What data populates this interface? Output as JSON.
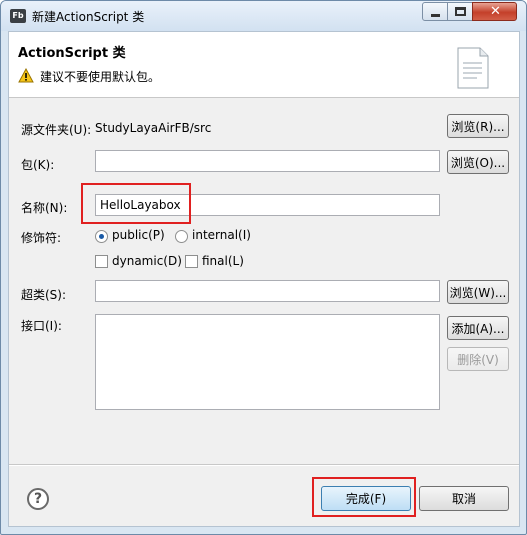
{
  "window": {
    "app_icon_text": "Fb",
    "title": "新建ActionScript 类",
    "close_glyph": "✕"
  },
  "banner": {
    "title": "ActionScript 类",
    "warning": "建议不要使用默认包。"
  },
  "form": {
    "source_folder": {
      "label": "源文件夹(U):",
      "value": "StudyLayaAirFB/src",
      "button": "浏览(R)..."
    },
    "package": {
      "label": "包(K):",
      "value": "",
      "button": "浏览(O)..."
    },
    "name": {
      "label": "名称(N):",
      "value": "HelloLayabox"
    },
    "modifiers": {
      "label": "修饰符:",
      "public": "public(P)",
      "internal": "internal(I)",
      "dynamic": "dynamic(D)",
      "final": "final(L)",
      "selected": "public"
    },
    "superclass": {
      "label": "超类(S):",
      "value": "",
      "button": "浏览(W)..."
    },
    "interfaces": {
      "label": "接口(I):",
      "add_button": "添加(A)...",
      "remove_button": "删除(V)"
    }
  },
  "footer": {
    "help_glyph": "?",
    "finish_button": "完成(F)",
    "cancel_button": "取消"
  },
  "colors": {
    "highlight": "#e02020",
    "title_bar": "#d2e1f1",
    "close_button": "#c4402a",
    "default_button": "#3c7fb1"
  }
}
